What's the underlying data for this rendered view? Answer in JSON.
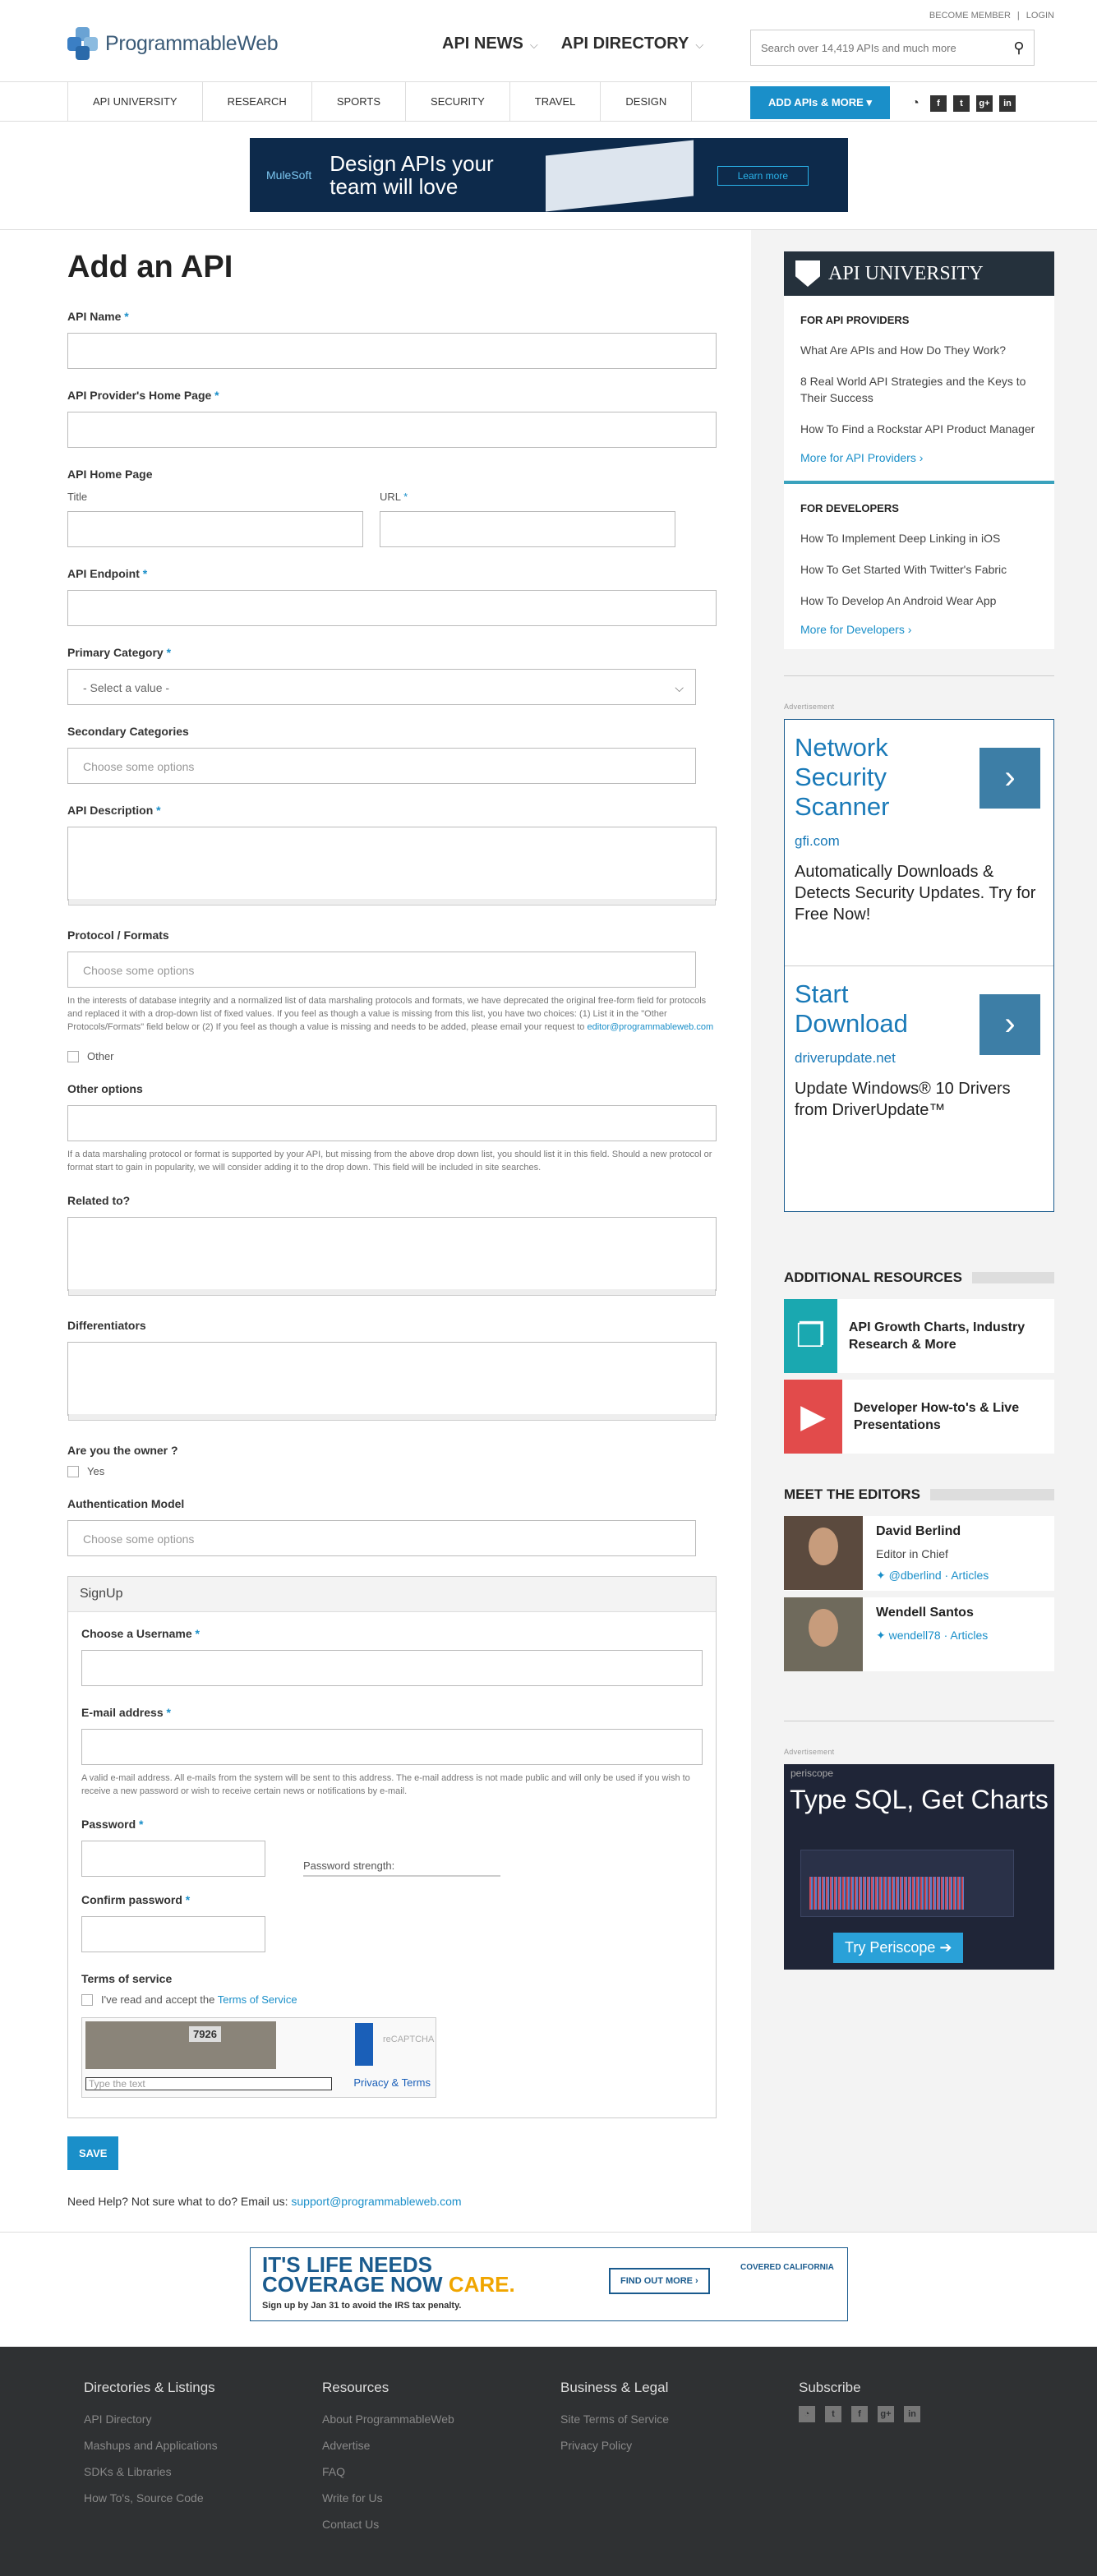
{
  "header": {
    "logo_text": "ProgrammableWeb",
    "nav": [
      "API NEWS",
      "API DIRECTORY"
    ],
    "member_links": [
      "BECOME MEMBER",
      "LOGIN"
    ],
    "search_placeholder": "Search over 14,419 APIs and much more",
    "subnav": [
      "API UNIVERSITY",
      "RESEARCH",
      "SPORTS",
      "SECURITY",
      "TRAVEL",
      "DESIGN"
    ],
    "add_button": "ADD APIs & MORE",
    "social": [
      "rss",
      "f",
      "t",
      "g+",
      "in"
    ]
  },
  "top_ad": {
    "brand": "MuleSoft",
    "headline": "Design APIs your team will love",
    "cta": "Learn more"
  },
  "form": {
    "title": "Add an API",
    "api_name_label": "API Name",
    "provider_home_label": "API Provider's Home Page",
    "api_home_label": "API Home Page",
    "title_label": "Title",
    "url_label": "URL",
    "endpoint_label": "API Endpoint",
    "primary_category_label": "Primary Category",
    "primary_category_value": "- Select a value -",
    "secondary_categories_label": "Secondary Categories",
    "choose_options": "Choose some options",
    "description_label": "API Description",
    "protocol_label": "Protocol / Formats",
    "protocol_help": "In the interests of database integrity and a normalized list of data marshaling protocols and formats, we have deprecated the original free-form field for protocols and replaced it with a drop-down list of fixed values. If you feel as though a value is missing from this list, you have two choices: (1) List it in the \"Other Protocols/Formats\" field below or (2) If you feel as though a value is missing and needs to be added, please email your request to",
    "protocol_help_email": "editor@programmableweb.com",
    "other_checkbox": "Other",
    "other_options_label": "Other options",
    "other_options_help": "If a data marshaling protocol or format is supported by your API, but missing from the above drop down list, you should list it in this field. Should a new protocol or format start to gain in popularity, we will consider adding it to the drop down. This field will be included in site searches.",
    "related_label": "Related to?",
    "differentiators_label": "Differentiators",
    "owner_label": "Are you the owner ?",
    "owner_yes": "Yes",
    "auth_label": "Authentication Model",
    "signup_title": "SignUp",
    "username_label": "Choose a Username",
    "email_label": "E-mail address",
    "email_help": "A valid e-mail address. All e-mails from the system will be sent to this address. The e-mail address is not made public and will only be used if you wish to receive a new password or wish to receive certain news or notifications by e-mail.",
    "password_label": "Password",
    "password_strength": "Password strength:",
    "confirm_label": "Confirm password",
    "tos_label": "Terms of service",
    "tos_text": "I've read and accept the",
    "tos_link": "Terms of Service",
    "captcha_number": "7926",
    "captcha_placeholder": "Type the text",
    "captcha_links": "Privacy & Terms",
    "save": "SAVE",
    "help_text": "Need Help? Not sure what to do? Email us:",
    "help_email": "support@programmableweb.com"
  },
  "sidebar": {
    "apiu_title": "API UNIVERSITY",
    "providers_heading": "FOR API PROVIDERS",
    "providers": [
      "What Are APIs and How Do They Work?",
      "8 Real World API Strategies and the Keys to Their Success",
      "How To Find a Rockstar API Product Manager"
    ],
    "providers_more": "More for API Providers ›",
    "developers_heading": "FOR DEVELOPERS",
    "developers": [
      "How To Implement Deep Linking in iOS",
      "How To Get Started With Twitter's Fabric",
      "How To Develop An Android Wear App"
    ],
    "developers_more": "More for Developers ›",
    "advertisement": "Advertisement",
    "ad1_title": "Network Security Scanner",
    "ad1_domain": "gfi.com",
    "ad1_desc": "Automatically Downloads & Detects Security Updates. Try for Free Now!",
    "ad2_title": "Start Download",
    "ad2_domain": "driverupdate.net",
    "ad2_desc": "Update Windows® 10 Drivers from DriverUpdate™",
    "resources_heading": "ADDITIONAL RESOURCES",
    "resources": [
      "API Growth Charts, Industry Research & More",
      "Developer How-to's & Live Presentations"
    ],
    "editors_heading": "MEET THE EDITORS",
    "editors": [
      {
        "name": "David Berlind",
        "role": "Editor in Chief",
        "handle": "@dberlind",
        "articles": "Articles"
      },
      {
        "name": "Wendell Santos",
        "role": "",
        "handle": "wendell78",
        "articles": "Articles"
      }
    ],
    "ad3_brand": "periscope",
    "ad3_headline": "Type SQL, Get Charts",
    "ad3_cta": "Try Periscope"
  },
  "bottom_ad": {
    "headline1": "IT'S LIFE NEEDS",
    "headline2": "COVERAGE NOW",
    "headline2b": "CARE.",
    "sub": "Sign up by Jan 31 to avoid the IRS tax penalty.",
    "cta": "FIND OUT MORE ›",
    "brand": "COVERED CALIFORNIA"
  },
  "footer": {
    "cols": [
      {
        "title": "Directories & Listings",
        "links": [
          "API Directory",
          "Mashups and Applications",
          "SDKs & Libraries",
          "How To's, Source Code"
        ]
      },
      {
        "title": "Resources",
        "links": [
          "About ProgrammableWeb",
          "Advertise",
          "FAQ",
          "Write for Us",
          "Contact Us"
        ]
      },
      {
        "title": "Business & Legal",
        "links": [
          "Site Terms of Service",
          "Privacy Policy"
        ]
      },
      {
        "title": "Subscribe",
        "links": []
      }
    ]
  }
}
